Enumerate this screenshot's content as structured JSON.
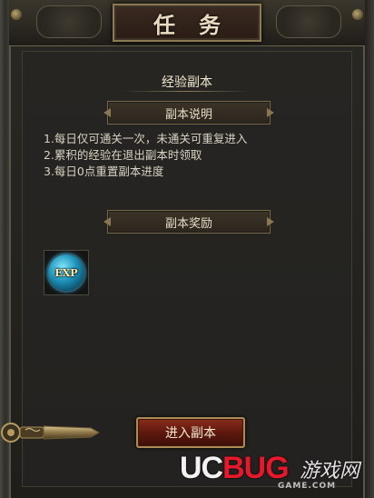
{
  "window": {
    "title": "任务"
  },
  "dungeon": {
    "name": "经验副本"
  },
  "description": {
    "header": "副本说明",
    "rules": [
      "1.每日仅可通关一次，未通关可重复进入",
      "2.累积的经验在退出副本时领取",
      "3.每日0点重置副本进度"
    ]
  },
  "rewards": {
    "header": "副本奖励",
    "items": [
      {
        "icon": "exp-orb-icon",
        "label": "EXP"
      }
    ]
  },
  "actions": {
    "enter_label": "进入副本"
  },
  "watermark": {
    "part1": "UC",
    "part2": "BUG",
    "cn": "游戏网",
    "sub": "GAME.COM"
  },
  "colors": {
    "accent_red": "#e8182c",
    "exp_blue": "#1c8fb6",
    "gold_border": "#b08a55"
  }
}
